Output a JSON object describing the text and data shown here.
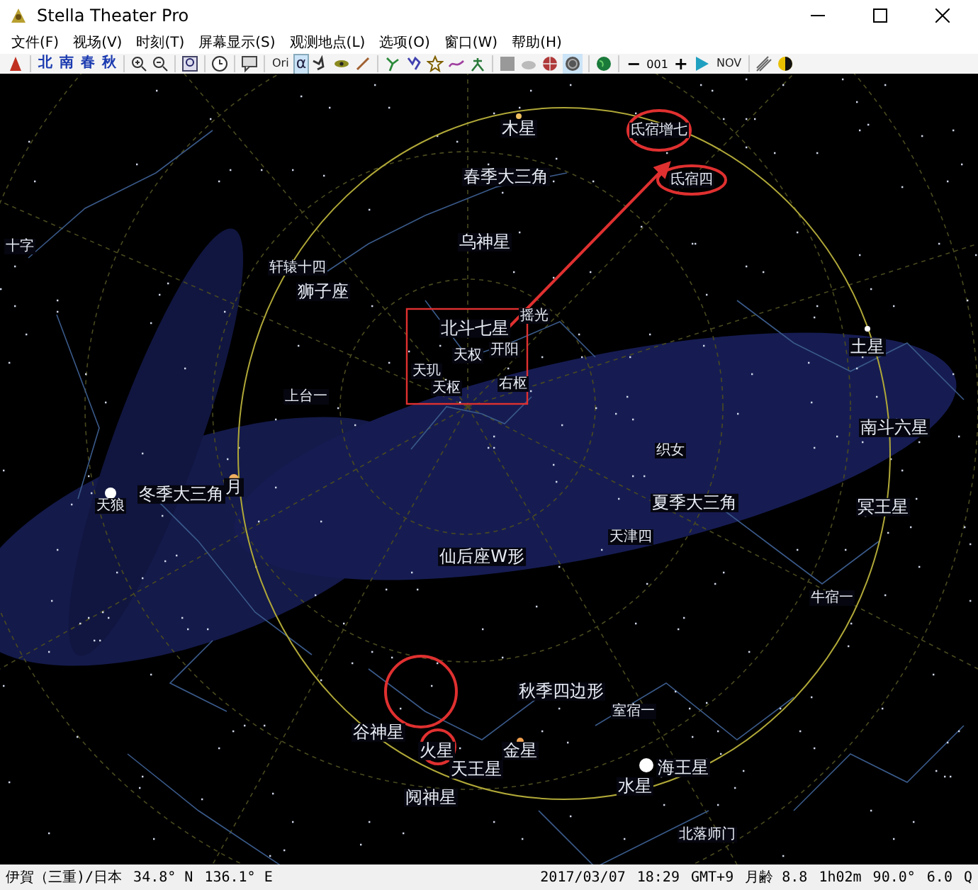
{
  "window": {
    "title": "Stella Theater Pro"
  },
  "menu": [
    "文件(F)",
    "视场(V)",
    "时刻(T)",
    "屏幕显示(S)",
    "观测地点(L)",
    "选项(O)",
    "窗口(W)",
    "帮助(H)"
  ],
  "toolbar": {
    "directions": [
      "北",
      "南",
      "春",
      "秋"
    ],
    "ori": "Ori",
    "alpha": {
      "label": "α",
      "selected": true
    },
    "minus": "−",
    "counter": "001",
    "plus": "+",
    "month": "NOV"
  },
  "sky_labels": [
    {
      "text": "氐宿增七",
      "kind": "star"
    },
    {
      "text": "氐宿四",
      "kind": "star"
    },
    {
      "text": "木星",
      "kind": "planet"
    },
    {
      "text": "春季大三角",
      "kind": "asterism"
    },
    {
      "text": "乌神星",
      "kind": "planet"
    },
    {
      "text": "轩辕十四",
      "kind": "star"
    },
    {
      "text": "狮子座",
      "kind": "asterism"
    },
    {
      "text": "北斗七星",
      "kind": "asterism"
    },
    {
      "text": "摇光",
      "kind": "star"
    },
    {
      "text": "天权",
      "kind": "star"
    },
    {
      "text": "开阳",
      "kind": "star"
    },
    {
      "text": "天玑",
      "kind": "star"
    },
    {
      "text": "天枢",
      "kind": "star"
    },
    {
      "text": "右枢",
      "kind": "star"
    },
    {
      "text": "冬季大三角",
      "kind": "asterism"
    },
    {
      "text": "天狼",
      "kind": "star"
    },
    {
      "text": "月",
      "kind": "planet"
    },
    {
      "text": "仙后座W形",
      "kind": "asterism"
    },
    {
      "text": "谷神星",
      "kind": "planet"
    },
    {
      "text": "火星",
      "kind": "planet"
    },
    {
      "text": "天王星",
      "kind": "planet"
    },
    {
      "text": "阋神星",
      "kind": "planet"
    },
    {
      "text": "秋季四边形",
      "kind": "asterism"
    },
    {
      "text": "金星",
      "kind": "planet"
    },
    {
      "text": "海王星",
      "kind": "planet"
    },
    {
      "text": "水星",
      "kind": "planet"
    },
    {
      "text": "夏季大三角",
      "kind": "asterism"
    },
    {
      "text": "土星",
      "kind": "planet"
    },
    {
      "text": "南斗六星",
      "kind": "asterism"
    },
    {
      "text": "冥王星",
      "kind": "planet"
    },
    {
      "text": "十字",
      "kind": "star"
    },
    {
      "text": "北落师门",
      "kind": "star"
    },
    {
      "text": "牛宿一",
      "kind": "star"
    },
    {
      "text": "室宿一",
      "kind": "star"
    },
    {
      "text": "上台一",
      "kind": "star"
    },
    {
      "text": "天津四",
      "kind": "star"
    },
    {
      "text": "织女",
      "kind": "star"
    }
  ],
  "status_bar": {
    "location": "伊賀（三重)/日本",
    "latitude": "34.8° N",
    "longitude": "136.1° E",
    "date": "2017/03/07",
    "time": "18:29",
    "timezone": "GMT+9",
    "moon_age": "月齢 8.8",
    "duration": "1h02m",
    "field": "90.0°",
    "magnitude": "6.0",
    "end": "Q"
  }
}
